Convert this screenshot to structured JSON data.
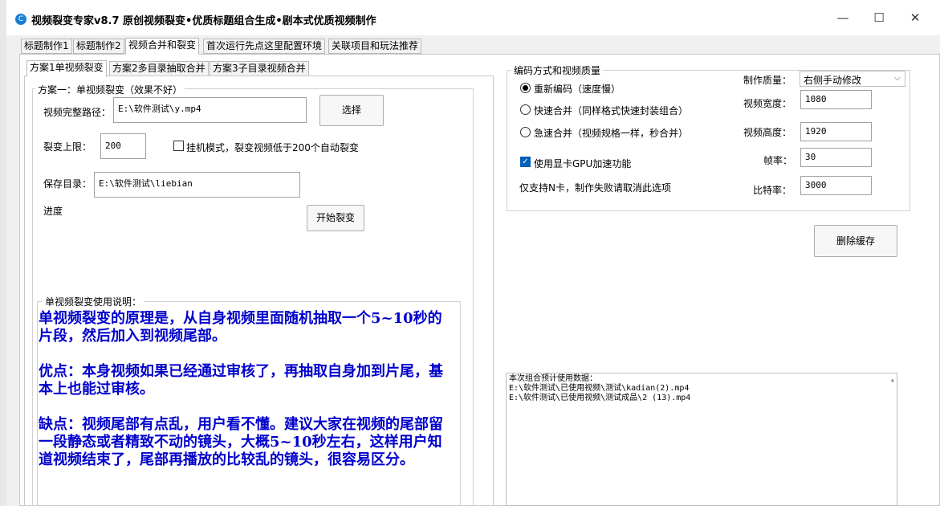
{
  "window": {
    "title": "视频裂变专家v8.7   原创视频裂变•优质标题组合生成•剧本式优质视频制作",
    "icon_glyph": "C",
    "minimize": "—",
    "maximize": "☐",
    "close": "✕"
  },
  "tabs": [
    "标题制作1",
    "标题制作2",
    "视频合并和裂变",
    "首次运行先点这里配置环境",
    "关联项目和玩法推荐"
  ],
  "subtabs": [
    "方案1单视频裂变",
    "方案2多目录抽取合并",
    "方案3子目录视频合并"
  ],
  "scheme1": {
    "group_title": "方案一：单视频裂变（效果不好）",
    "path_label": "视频完整路径：",
    "path_value": "E:\\软件测试\\y.mp4",
    "select_button": "选择",
    "limit_label": "裂变上限：",
    "limit_value": "200",
    "hang_checkbox_label": "挂机模式，裂变视频低于200个自动裂变",
    "save_label": "保存目录：",
    "save_value": "E:\\软件测试\\liebian",
    "progress_label": "进度",
    "start_button": "开始裂变"
  },
  "instructions": {
    "title": "单视频裂变使用说明：",
    "paragraphs": [
      "单视频裂变的原理是，从自身视频里面随机抽取一个5~10秒的片段，然后加入到视频尾部。",
      "优点：本身视频如果已经通过审核了，再抽取自身加到片尾，基本上也能过审核。",
      "缺点：视频尾部有点乱，用户看不懂。建议大家在视频的尾部留一段静态或者精致不动的镜头，大概5~10秒左右，这样用户知道视频结束了，尾部再播放的比较乱的镜头，很容易区分。"
    ]
  },
  "encoding": {
    "group_title": "编码方式和视频质量",
    "radio_reencode": "重新编码（速度慢）",
    "radio_fast": "快速合并（同样格式快速封装组合）",
    "radio_urgent": "急速合并（视频规格一样，秒合并）",
    "gpu_label": "使用显卡GPU加速功能",
    "nvidia_note": "仅支持N卡，制作失败请取消此选项",
    "quality_label": "制作质量：",
    "quality_value": "右侧手动修改",
    "width_label": "视频宽度：",
    "width_value": "1080",
    "height_label": "视频高度：",
    "height_value": "1920",
    "fps_label": "帧率：",
    "fps_value": "30",
    "bitrate_label": "比特率：",
    "bitrate_value": "3000"
  },
  "clear_cache_button": "删除缓存",
  "log": {
    "lines": [
      "本次组合预计使用数据：",
      "E:\\软件测试\\已使用视频\\测试\\kadian(2).mp4",
      "E:\\软件测试\\已使用视频\\测试成品\\2 (13).mp4"
    ]
  },
  "colors": {
    "instruction_text": "#0000cc",
    "checkbox_accent": "#005fb8"
  }
}
